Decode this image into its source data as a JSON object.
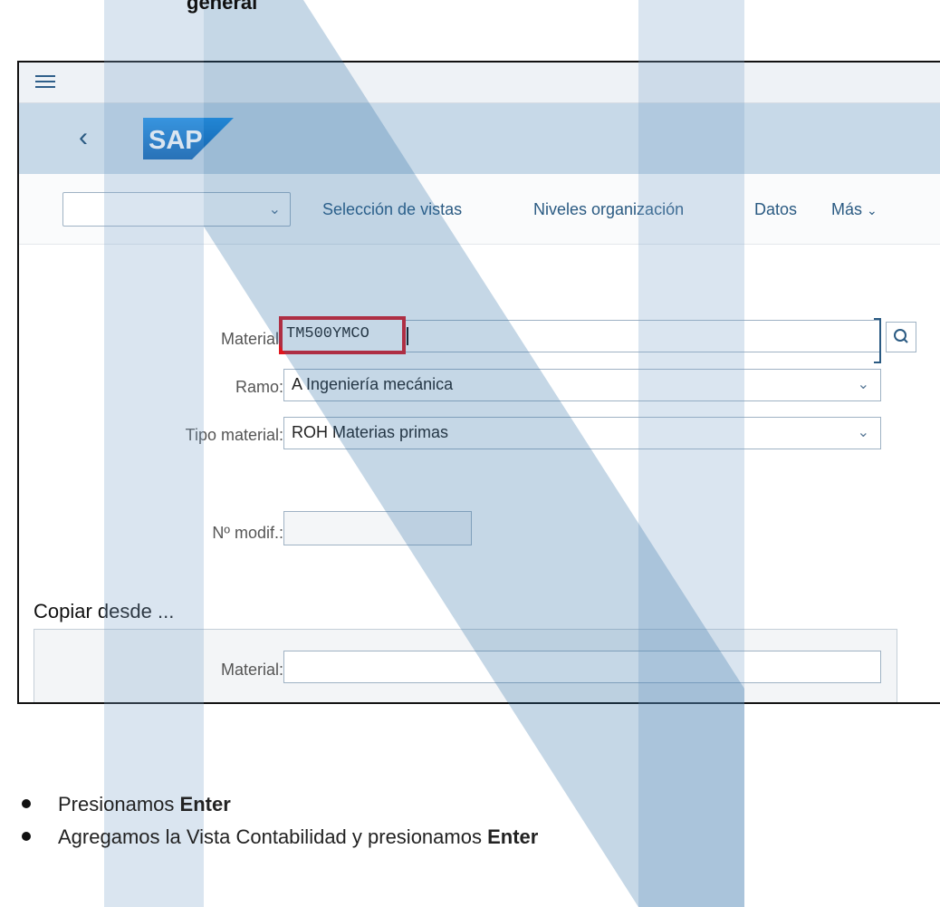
{
  "heading_fragment": "general",
  "app": {
    "logo_text": "SAP",
    "toolbar": {
      "combo_value": "",
      "items": [
        "Selección de vistas",
        "Niveles organización",
        "Datos",
        "Más"
      ]
    },
    "form": {
      "material_label": "Material:",
      "material_value": "TM500YMCO",
      "ramo_label": "Ramo:",
      "ramo_value": "A Ingeniería mecánica",
      "tipo_label": "Tipo material:",
      "tipo_value": "ROH Materias primas",
      "modif_label": "Nº modif.:",
      "modif_value": ""
    },
    "copy_section": {
      "title": "Copiar desde ...",
      "material_label": "Material:",
      "material_value": ""
    }
  },
  "bullets": [
    {
      "text": "Presionamos ",
      "bold": "Enter"
    },
    {
      "text": "Agregamos la Vista Contabilidad y presionamos ",
      "bold": "Enter"
    }
  ],
  "colors": {
    "highlight": "#e0161e",
    "shellbar": "#c7d9e8",
    "link": "#2a5a82",
    "sap_blue": "#0a6ed1"
  }
}
